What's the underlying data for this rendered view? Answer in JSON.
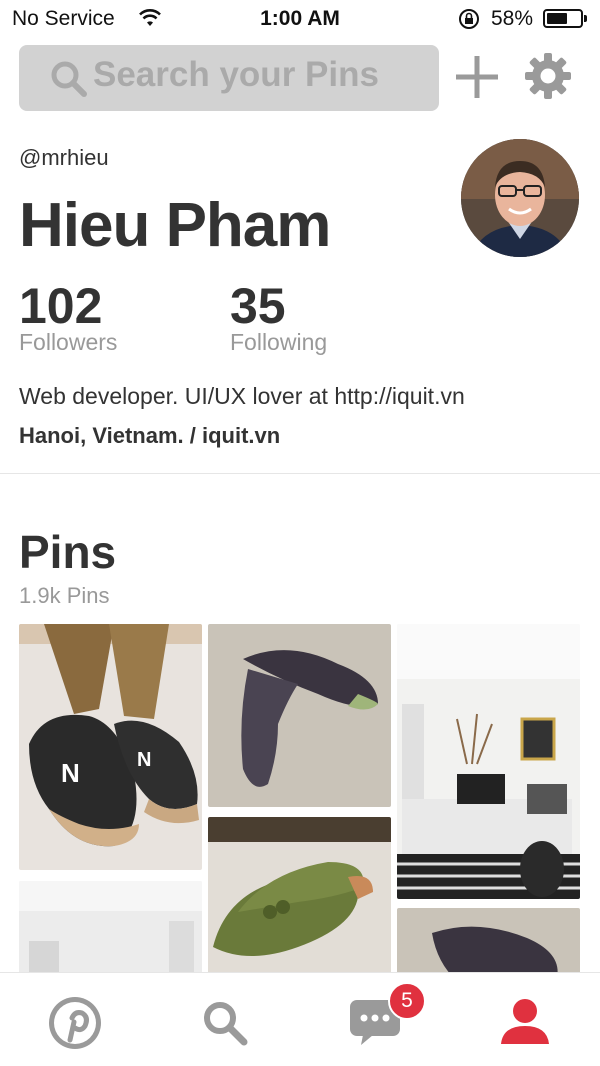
{
  "status_bar": {
    "carrier": "No Service",
    "time": "1:00 AM",
    "battery_percent": "58%",
    "battery_level": 0.58
  },
  "search": {
    "placeholder": "Search your Pins"
  },
  "profile": {
    "handle": "@mrhieu",
    "name": "Hieu Pham",
    "followers_count": "102",
    "followers_label": "Followers",
    "following_count": "35",
    "following_label": "Following",
    "bio": "Web developer. UI/UX lover at http://iquit.vn",
    "location": "Hanoi, Vietnam. / iquit.vn"
  },
  "pins_section": {
    "title": "Pins",
    "count": "1.9k Pins"
  },
  "tabbar": {
    "messages_badge": "5",
    "active_tab": "profile"
  },
  "colors": {
    "accent_red": "#e0313f",
    "icon_gray": "#9a9a9a",
    "text_dark": "#333333",
    "text_muted": "#999999",
    "search_bg": "#d2d2d2"
  }
}
